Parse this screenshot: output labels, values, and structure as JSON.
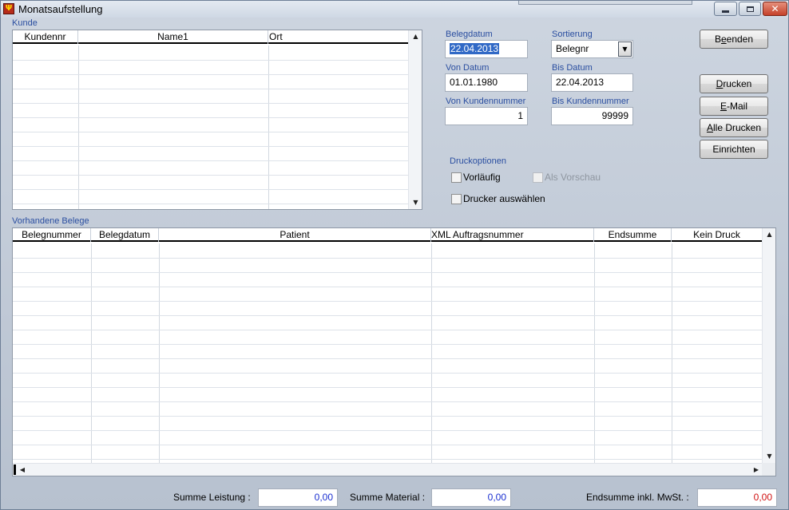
{
  "window": {
    "title": "Monatsaufstellung",
    "icon": "app-icon"
  },
  "kunde": {
    "group_label": "Kunde",
    "columns": [
      "Kundennr",
      "Name1",
      "Ort"
    ]
  },
  "form": {
    "belegdatum_label": "Belegdatum",
    "belegdatum_value": "22.04.2013",
    "sortierung_label": "Sortierung",
    "sortierung_value": "Belegnr",
    "von_datum_label": "Von Datum",
    "von_datum_value": "01.01.1980",
    "bis_datum_label": "Bis Datum",
    "bis_datum_value": "22.04.2013",
    "von_kundennummer_label": "Von Kundennummer",
    "von_kundennummer_value": "1",
    "bis_kundennummer_label": "Bis Kundennummer",
    "bis_kundennummer_value": "99999"
  },
  "buttons": {
    "beenden": [
      "B",
      "e",
      "enden"
    ],
    "drucken": [
      "",
      "D",
      "rucken"
    ],
    "email": [
      "",
      "E",
      "-Mail"
    ],
    "alle_drucken": [
      "",
      "A",
      "lle Drucken"
    ],
    "einrichten": [
      "",
      "",
      "Einrichten"
    ]
  },
  "druckoptionen": {
    "label": "Druckoptionen",
    "vorlaeufig": "Vorläufig",
    "als_vorschau": "Als Vorschau",
    "drucker_auswaehlen": "Drucker auswählen"
  },
  "belege": {
    "group_label": "Vorhandene Belege",
    "columns": [
      "Belegnummer",
      "Belegdatum",
      "Patient",
      "XML Auftragsnummer",
      "Endsumme",
      "Kein Druck"
    ]
  },
  "summen": {
    "leistung_label": "Summe Leistung :",
    "leistung_value": "0,00",
    "material_label": "Summe Material :",
    "material_value": "0,00",
    "endsumme_label": "Endsumme inkl. MwSt. :",
    "endsumme_value": "0,00"
  },
  "colors": {
    "label_blue": "#2a4ea0",
    "value_blue": "#1a2fd0",
    "value_red": "#d01010",
    "selection": "#3169c6"
  }
}
